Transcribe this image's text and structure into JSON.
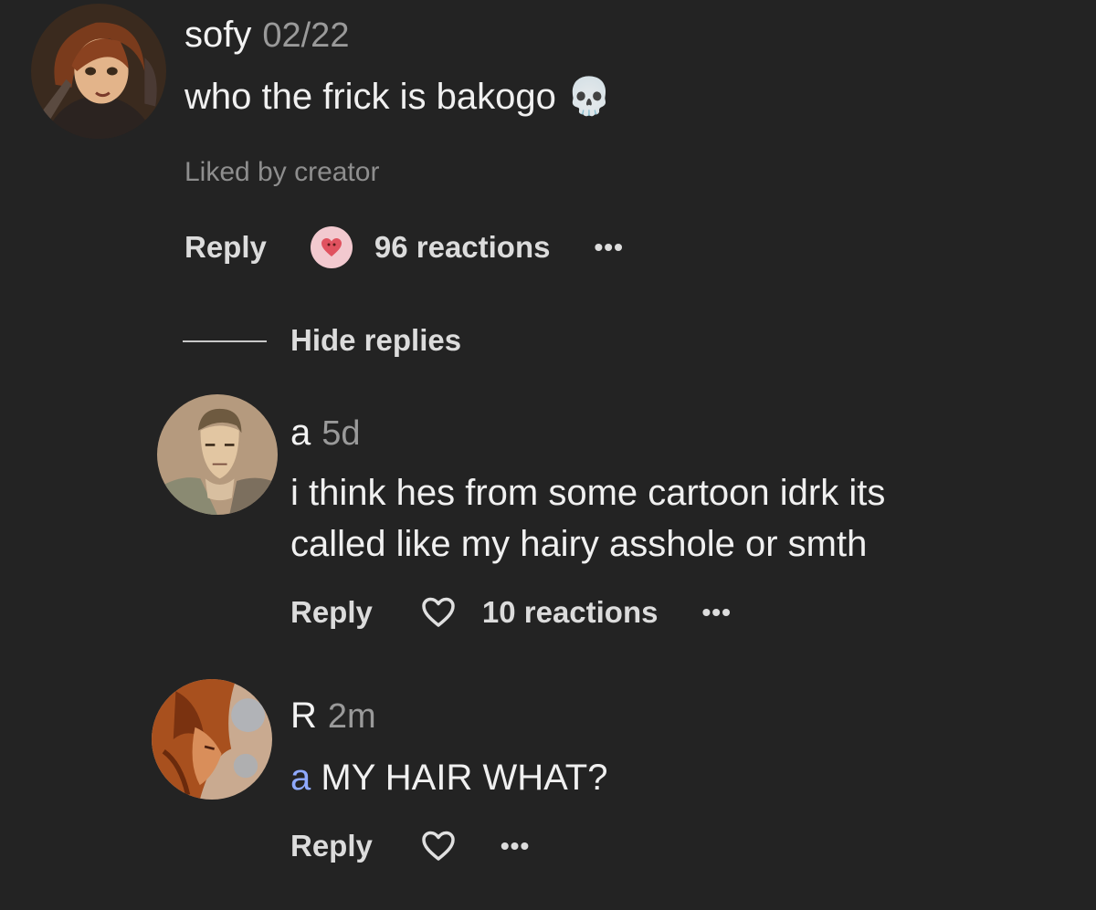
{
  "comments": [
    {
      "username": "sofy",
      "timestamp": "02/22",
      "text": "who the frick is bakogo",
      "emoji": "💀",
      "liked_by": "Liked by creator",
      "reply_label": "Reply",
      "reactions": "96 reactions",
      "more": "•••"
    }
  ],
  "hide_replies": "Hide replies",
  "replies": [
    {
      "username": "a",
      "timestamp": "5d",
      "text_line1": "i think hes from some cartoon idrk its",
      "text_line2": "called like my hairy asshole or smth",
      "reply_label": "Reply",
      "reactions": "10 reactions",
      "more": "•••"
    },
    {
      "username": "R",
      "timestamp": "2m",
      "mention": "a",
      "text": "MY HAIR WHAT?",
      "reply_label": "Reply",
      "more": "•••"
    }
  ],
  "colors": {
    "background": "#232323",
    "mention": "#8fa9ff",
    "reaction_badge": "#f2c9cf"
  }
}
